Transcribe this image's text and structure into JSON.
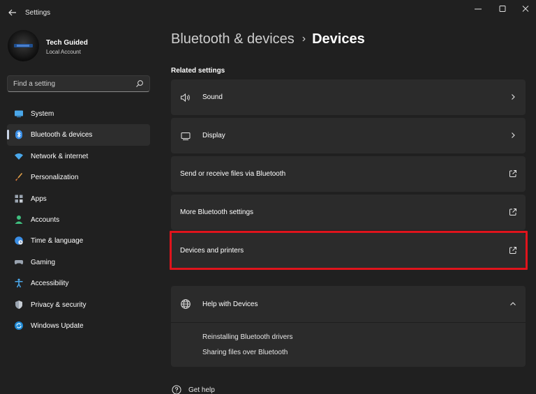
{
  "window": {
    "title": "Settings",
    "controls": [
      "minimize",
      "maximize",
      "close"
    ]
  },
  "profile": {
    "name": "Tech Guided",
    "account_type": "Local Account"
  },
  "search": {
    "placeholder": "Find a setting"
  },
  "sidebar": {
    "active_index": 1,
    "items": [
      {
        "label": "System",
        "icon": "system-icon"
      },
      {
        "label": "Bluetooth & devices",
        "icon": "bluetooth-icon"
      },
      {
        "label": "Network & internet",
        "icon": "wifi-icon"
      },
      {
        "label": "Personalization",
        "icon": "brush-icon"
      },
      {
        "label": "Apps",
        "icon": "apps-icon"
      },
      {
        "label": "Accounts",
        "icon": "person-icon"
      },
      {
        "label": "Time & language",
        "icon": "globe-clock-icon"
      },
      {
        "label": "Gaming",
        "icon": "gamepad-icon"
      },
      {
        "label": "Accessibility",
        "icon": "accessibility-icon"
      },
      {
        "label": "Privacy & security",
        "icon": "shield-icon"
      },
      {
        "label": "Windows Update",
        "icon": "update-icon"
      }
    ]
  },
  "breadcrumb": {
    "parent": "Bluetooth & devices",
    "separator": "›",
    "current": "Devices"
  },
  "related_settings": {
    "title": "Related settings",
    "items": [
      {
        "label": "Sound",
        "icon": "speaker-icon",
        "action": "chevron-right-icon"
      },
      {
        "label": "Display",
        "icon": "monitor-icon",
        "action": "chevron-right-icon"
      },
      {
        "label": "Send or receive files via Bluetooth",
        "icon": "",
        "action": "open-external-icon"
      },
      {
        "label": "More Bluetooth settings",
        "icon": "",
        "action": "open-external-icon"
      },
      {
        "label": "Devices and printers",
        "icon": "",
        "action": "open-external-icon",
        "highlighted": true
      }
    ]
  },
  "help": {
    "title": "Help with Devices",
    "icon": "globe-icon",
    "expanded": true,
    "links": [
      "Reinstalling Bluetooth drivers",
      "Sharing files over Bluetooth"
    ]
  },
  "footer": {
    "get_help": "Get help"
  },
  "colors": {
    "background": "#202020",
    "card": "#2b2b2b",
    "highlight": "#e0141c",
    "accent": "#4cc2ff"
  }
}
